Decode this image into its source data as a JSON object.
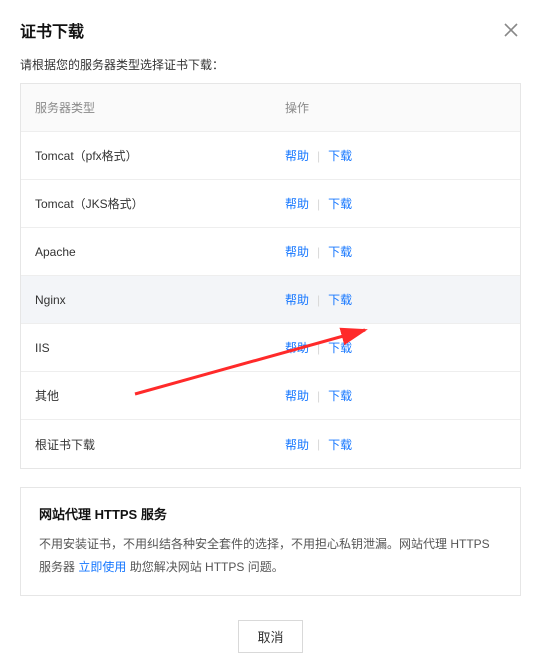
{
  "header": {
    "title": "证书下载"
  },
  "subtitle": "请根据您的服务器类型选择证书下载：",
  "table": {
    "col_server": "服务器类型",
    "col_ops": "操作",
    "rows": [
      {
        "name": "Tomcat（pfx格式）",
        "help": "帮助",
        "download": "下载",
        "highlight": false
      },
      {
        "name": "Tomcat（JKS格式）",
        "help": "帮助",
        "download": "下载",
        "highlight": false
      },
      {
        "name": "Apache",
        "help": "帮助",
        "download": "下载",
        "highlight": false
      },
      {
        "name": "Nginx",
        "help": "帮助",
        "download": "下载",
        "highlight": true
      },
      {
        "name": "IIS",
        "help": "帮助",
        "download": "下载",
        "highlight": false
      },
      {
        "name": "其他",
        "help": "帮助",
        "download": "下载",
        "highlight": false
      },
      {
        "name": "根证书下载",
        "help": "帮助",
        "download": "下载",
        "highlight": false
      }
    ]
  },
  "panel": {
    "title": "网站代理 HTTPS 服务",
    "text_before": "不用安装证书，不用纠结各种安全套件的选择，不用担心私钥泄漏。网站代理 HTTPS 服务器 ",
    "link": "立即使用",
    "text_after": " 助您解决网站 HTTPS 问题。"
  },
  "footer": {
    "cancel": "取消"
  }
}
